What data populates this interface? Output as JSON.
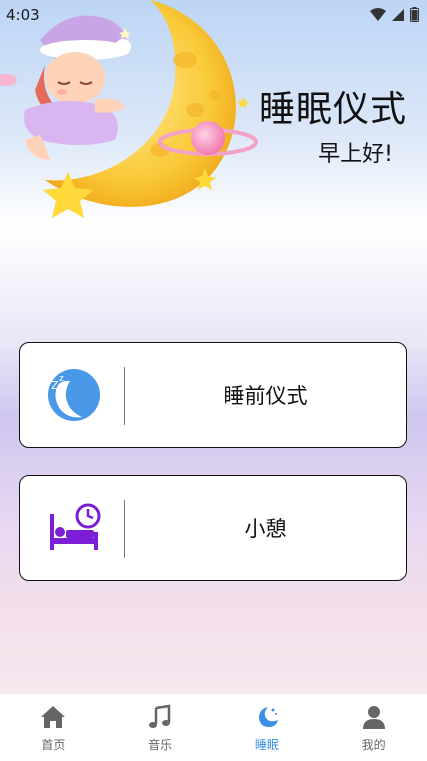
{
  "status": {
    "time": "4:03"
  },
  "header": {
    "title": "睡眠仪式",
    "greeting": "早上好!"
  },
  "cards": [
    {
      "label": "睡前仪式",
      "icon": "sleeping-moon-icon"
    },
    {
      "label": "小憩",
      "icon": "bed-clock-icon"
    }
  ],
  "nav": {
    "items": [
      {
        "label": "首页",
        "icon": "home-icon"
      },
      {
        "label": "音乐",
        "icon": "music-note-icon"
      },
      {
        "label": "睡眠",
        "icon": "moon-icon",
        "active": true
      },
      {
        "label": "我的",
        "icon": "person-icon"
      }
    ]
  },
  "colors": {
    "accent": "#3a8ee6",
    "nap_icon": "#7b1fd6"
  }
}
